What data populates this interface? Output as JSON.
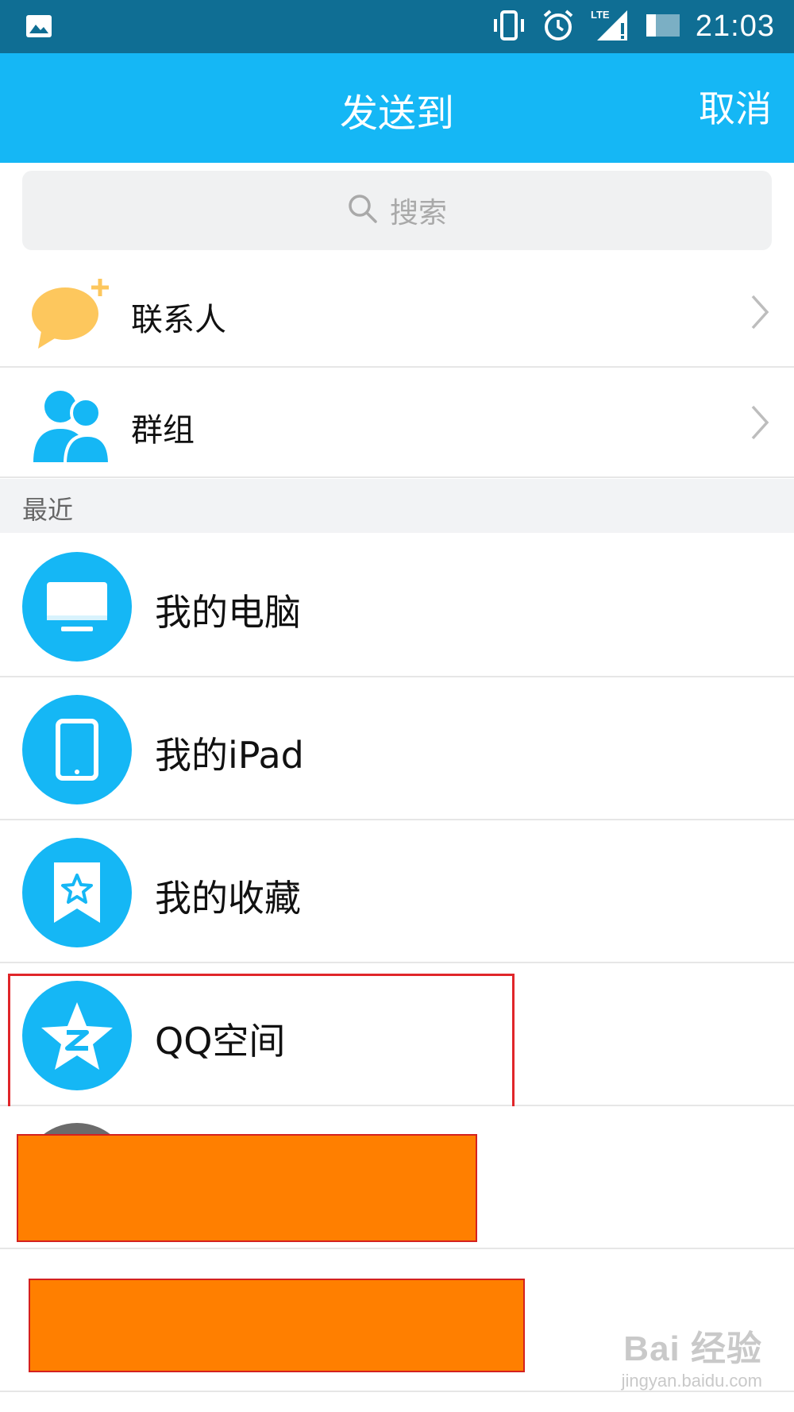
{
  "status_bar": {
    "time": "21:03",
    "icons": [
      "image-icon",
      "vibrate-icon",
      "alarm-icon",
      "lte-signal-icon",
      "battery-icon"
    ],
    "network_label": "LTE"
  },
  "header": {
    "title": "发送到",
    "cancel_label": "取消"
  },
  "search": {
    "placeholder": "搜索"
  },
  "entries": [
    {
      "label": "联系人",
      "icon": "contacts-bubble-icon"
    },
    {
      "label": "群组",
      "icon": "group-people-icon"
    }
  ],
  "section": {
    "recent_label": "最近"
  },
  "recent": [
    {
      "label": "我的电脑",
      "icon": "monitor-icon"
    },
    {
      "label": "我的iPad",
      "icon": "tablet-icon"
    },
    {
      "label": "我的收藏",
      "icon": "favorites-star-icon"
    },
    {
      "label": "QQ空间",
      "icon": "qzone-star-icon",
      "highlighted": true
    }
  ],
  "watermark": {
    "main": "Bai 经验",
    "sub": "jingyan.baidu.com"
  },
  "colors": {
    "status_bar": "#0f6e94",
    "header": "#15b7f5",
    "highlight": "#e0262a",
    "redaction": "#ff7f00"
  }
}
